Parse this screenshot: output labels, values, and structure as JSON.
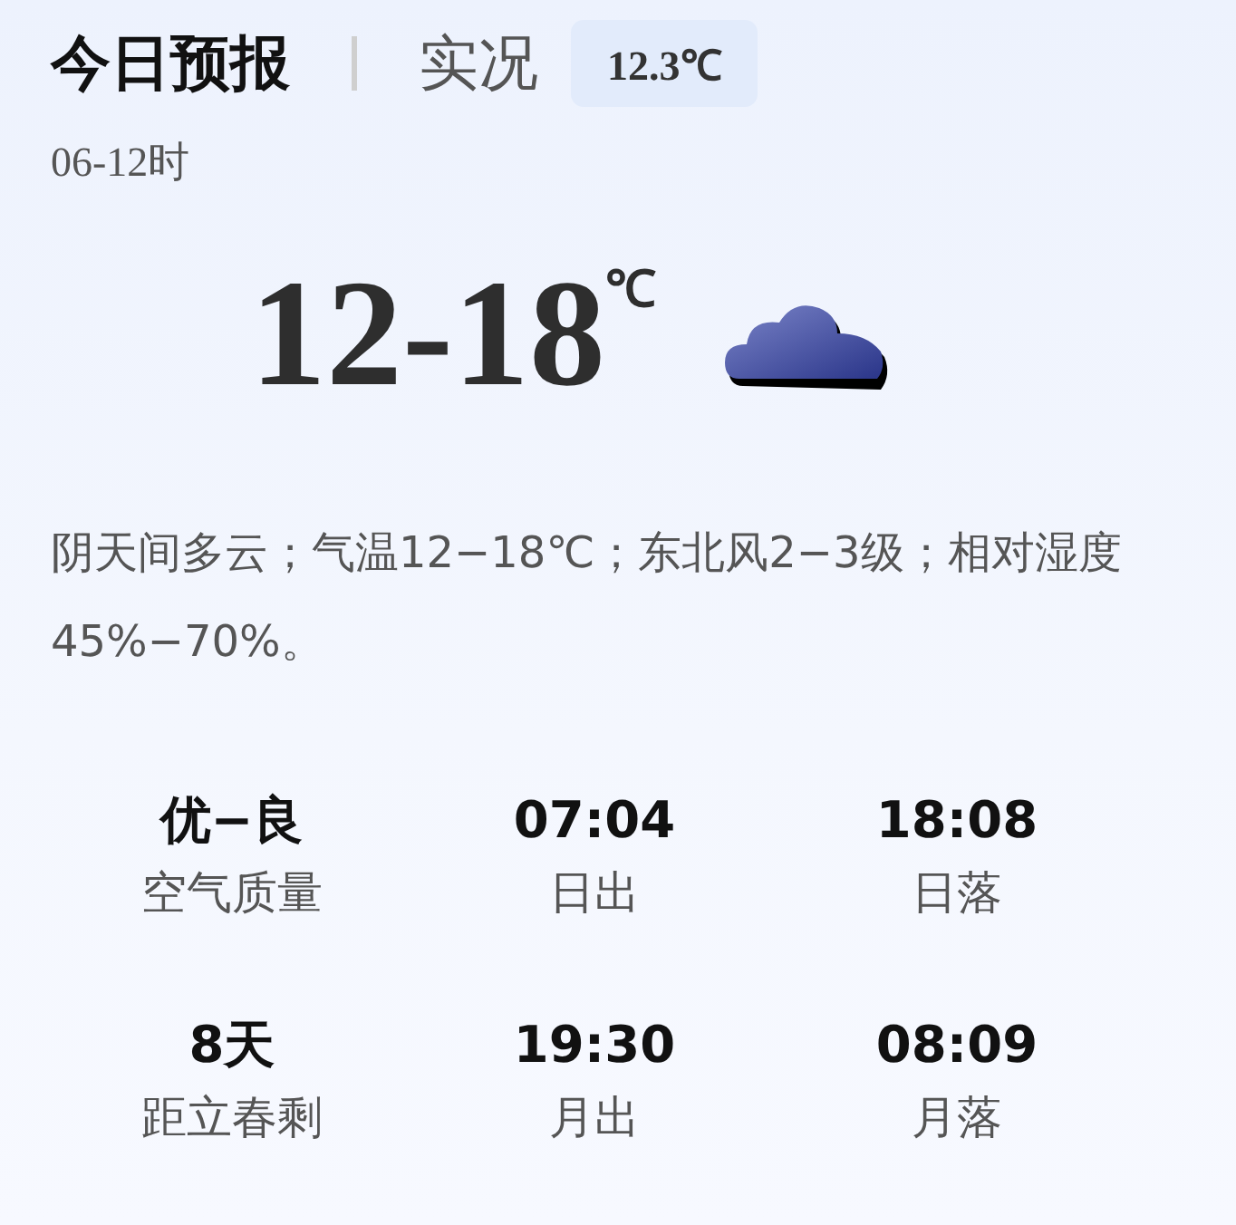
{
  "tabs": [
    {
      "label": "今日预报",
      "selected": true
    },
    {
      "label": "实况",
      "selected": false
    }
  ],
  "current_temp": "12.3℃",
  "period": "06-12时",
  "temp_range": "12-18",
  "temp_unit": "℃",
  "weather": {
    "kind": "cloudy"
  },
  "description": "阴天间多云；气温12−18℃；东北风2−3级；相对湿度45%−70%。",
  "stats": [
    {
      "value": "优−良",
      "label": "空气质量"
    },
    {
      "value": "07:04",
      "label": "日出"
    },
    {
      "value": "18:08",
      "label": "日落"
    },
    {
      "value": "8天",
      "label": "距立春剩"
    },
    {
      "value": "19:30",
      "label": "月出"
    },
    {
      "value": "08:09",
      "label": "月落"
    }
  ]
}
